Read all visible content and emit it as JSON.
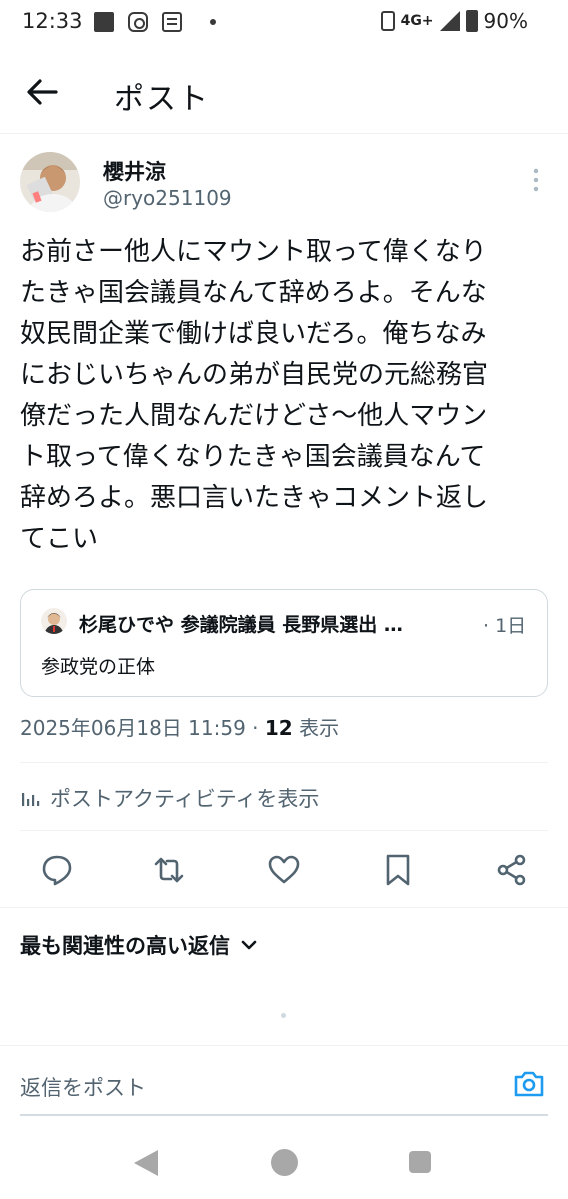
{
  "status_bar": {
    "time": "12:33",
    "network": "4G+",
    "battery": "90%"
  },
  "header": {
    "title": "ポスト",
    "back_icon": "arrow-left-icon"
  },
  "post": {
    "author_name": "櫻井涼",
    "author_handle": "@ryo251109",
    "body": "お前さー他人にマウント取って偉くなり\nたきゃ国会議員なんて辞めろよ。そんな\n奴民間企業で働けば良いだろ。俺ちなみ\nにおじいちゃんの弟が自民党の元総務官\n僚だった人間なんだけどさ〜他人マウン\nト取って偉くなりたきゃ国会議員なんて\n辞めろよ。悪口言いたきゃコメント返し\nてこい",
    "quote": {
      "name": "杉尾ひでや 参議院議員 長野県選出 …",
      "time": "· 1日",
      "text": "参政党の正体"
    },
    "timestamp": "2025年06月18日 11:59 · ",
    "views_count": "12",
    "views_label": " 表示",
    "activity_label": "ポストアクティビティを表示"
  },
  "actions": [
    "reply-icon",
    "repost-icon",
    "like-icon",
    "bookmark-icon",
    "share-icon"
  ],
  "replies": {
    "sort_label": "最も関連性の高い返信",
    "input_placeholder": "返信をポスト"
  },
  "colors": {
    "accent": "#1d9bf0",
    "text": "#0f1419",
    "secondary": "#536471"
  }
}
